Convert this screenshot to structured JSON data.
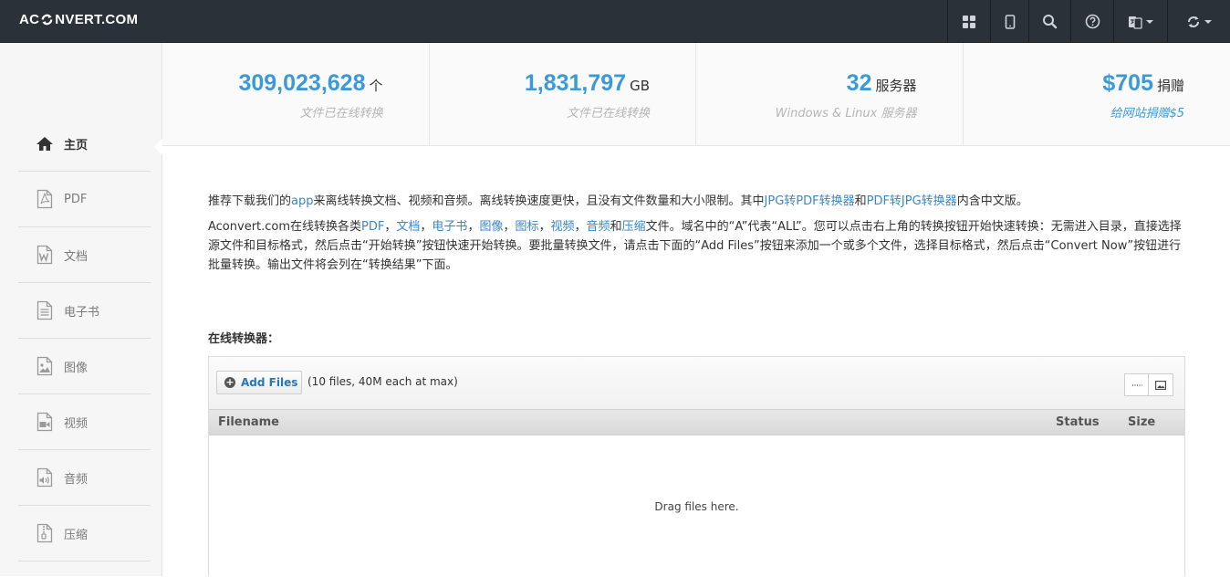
{
  "header": {
    "logo_left": "AC",
    "logo_right": "NVERT.COM",
    "icons": [
      "grid-icon",
      "mobile-icon",
      "search-icon",
      "help-icon",
      "language-icon",
      "convert-icon"
    ]
  },
  "sidebar": {
    "items": [
      {
        "label": "主页",
        "icon": "home-icon",
        "active": true
      },
      {
        "label": "PDF",
        "icon": "pdf-icon"
      },
      {
        "label": "文档",
        "icon": "document-icon"
      },
      {
        "label": "电子书",
        "icon": "ebook-icon"
      },
      {
        "label": "图像",
        "icon": "image-icon"
      },
      {
        "label": "视频",
        "icon": "video-icon"
      },
      {
        "label": "音频",
        "icon": "audio-icon"
      },
      {
        "label": "压缩",
        "icon": "archive-icon"
      }
    ]
  },
  "stats": [
    {
      "number": "309,023,628",
      "unit": "个",
      "caption": "文件已在线转换"
    },
    {
      "number": "1,831,797",
      "unit": "GB",
      "caption": "文件已在线转换"
    },
    {
      "number": "32",
      "unit": "服务器",
      "caption": "Windows & Linux 服务器"
    },
    {
      "number": "$705",
      "unit": "捐赠",
      "caption": "给网站捐赠$5"
    }
  ],
  "intro": {
    "p1": {
      "t1": "推荐下载我们的",
      "app": "app",
      "t2": "来离线转换文档、视频和音频。离线转换速度更快，且没有文件数量和大小限制。其中",
      "jpg_pdf": "JPG转PDF转换器",
      "t3": "和",
      "pdf_jpg": "PDF转JPG转换器",
      "t4": "内含中文版。"
    },
    "p2": {
      "t1": "Aconvert.com在线转换各类",
      "links": [
        "PDF",
        "文档",
        "电子书",
        "图像",
        "图标",
        "视频",
        "音频"
      ],
      "sep": "，",
      "and": "和",
      "zip": "压缩",
      "t2": "文件。域名中的“A”代表“ALL”。您可以点击右上角的转换按钮开始快速转换：无需进入目录，直接选择源文件和目标格式，然后点击“开始转换”按钮快速开始转换。要批量转换文件，请点击下面的“Add Files”按钮来添加一个或多个文件，选择目标格式，然后点击“Convert Now”按钮进行批量转换。输出文件将会列在“转换结果”下面。"
    }
  },
  "converter": {
    "title": "在线转换器：",
    "add_files": "Add Files",
    "limit": "(10 files, 40M each at max)",
    "columns": {
      "filename": "Filename",
      "status": "Status",
      "size": "Size"
    },
    "drop_text": "Drag files here."
  }
}
